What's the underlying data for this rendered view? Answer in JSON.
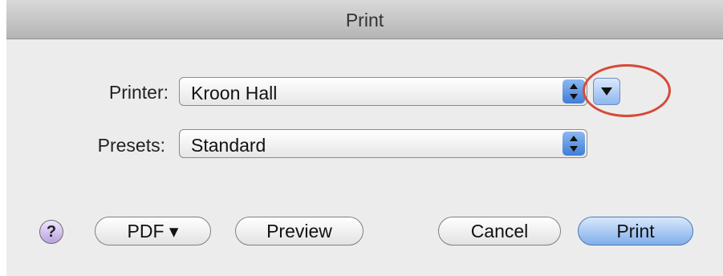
{
  "window": {
    "title": "Print"
  },
  "printer": {
    "label": "Printer:",
    "value": "Kroon Hall"
  },
  "presets": {
    "label": "Presets:",
    "value": "Standard"
  },
  "footer": {
    "help_glyph": "?",
    "pdf_label": "PDF ▾",
    "preview_label": "Preview",
    "cancel_label": "Cancel",
    "print_label": "Print"
  },
  "icons": {
    "stepper": "updown-arrows-icon",
    "disclosure": "disclosure-triangle-icon",
    "help": "help-icon"
  },
  "colors": {
    "accent": "#4a88e0",
    "highlight_ring": "#d64a39"
  }
}
